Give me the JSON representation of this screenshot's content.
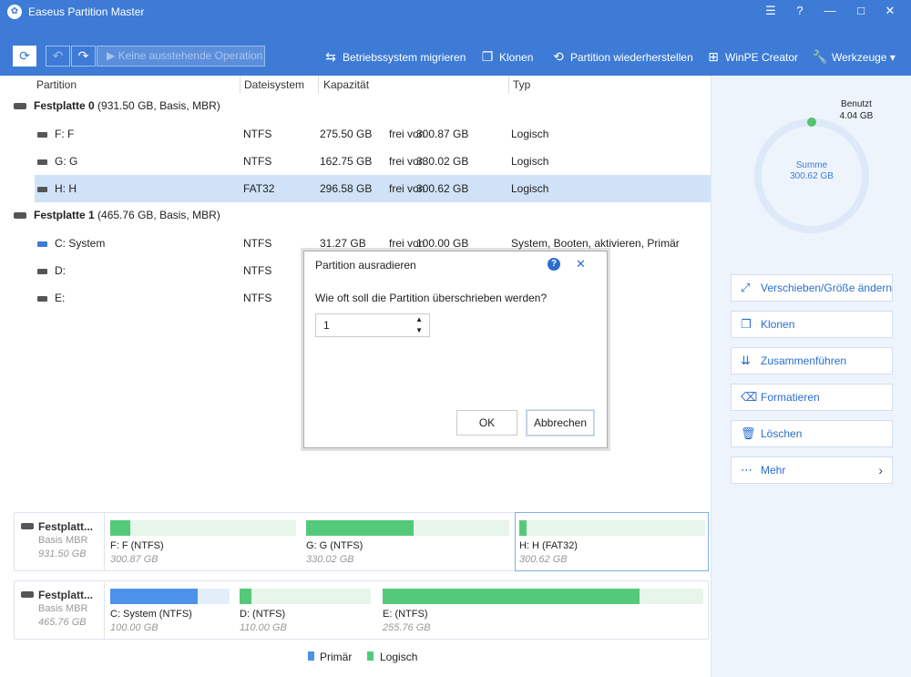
{
  "app": {
    "title": "Easeus Partition Master",
    "logo": "✿"
  },
  "window_buttons": [
    "☰",
    "?",
    "—",
    "□",
    "✕"
  ],
  "toolbar": {
    "refresh": "⟳",
    "undo": "↶",
    "redo": "↷",
    "pending_label": "Keine ausstehende Operation",
    "items": [
      {
        "label": "Betriebssystem migrieren",
        "icon": "⇆"
      },
      {
        "label": "Klonen",
        "icon": "❐"
      },
      {
        "label": "Partition wiederherstellen",
        "icon": "⟲"
      },
      {
        "label": "WinPE Creator",
        "icon": "⊞"
      },
      {
        "label": "Werkzeuge",
        "icon": "🔧",
        "arrow": "▾"
      }
    ]
  },
  "columns": [
    "Partition",
    "Dateisystem",
    "Kapazität",
    "Typ"
  ],
  "disks": [
    {
      "name": "Festplatte 0",
      "info": "(931.50 GB, Basis, MBR)",
      "partitions": [
        {
          "name": "F: F",
          "fs": "NTFS",
          "free": "275.50 GB",
          "frei": "frei von",
          "total": "300.87 GB",
          "type": "Logisch"
        },
        {
          "name": "G: G",
          "fs": "NTFS",
          "free": "162.75 GB",
          "frei": "frei von",
          "total": "330.02 GB",
          "type": "Logisch"
        },
        {
          "name": "H: H",
          "fs": "FAT32",
          "free": "296.58 GB",
          "frei": "frei von",
          "total": "300.62 GB",
          "type": "Logisch"
        }
      ]
    },
    {
      "name": "Festplatte 1",
      "info": "(465.76 GB, Basis, MBR)",
      "partitions": [
        {
          "name": "C: System",
          "fs": "NTFS",
          "free": "31.27 GB",
          "frei": "frei von",
          "total": "100.00 GB",
          "type": "System, Booten, aktivieren, Primär"
        },
        {
          "name": "D:",
          "fs": "NTFS"
        },
        {
          "name": "E:",
          "fs": "NTFS"
        }
      ]
    }
  ],
  "dialog": {
    "title": "Partition ausradieren",
    "question": "Wie oft soll die Partition überschrieben werden?",
    "value": "1",
    "ok": "OK",
    "cancel": "Abbrechen",
    "help": "?",
    "close": "✕"
  },
  "usage": {
    "used_label": "Benutzt",
    "used_value": "4.04 GB",
    "sum_label": "Summe",
    "sum_value": "300.62 GB",
    "used_fraction": 0.013
  },
  "actions": [
    {
      "label": "Verschieben/Größe ändern",
      "icon": "⤢"
    },
    {
      "label": "Klonen",
      "icon": "❐"
    },
    {
      "label": "Zusammenführen",
      "icon": "⇊"
    },
    {
      "label": "Formatieren",
      "icon": "⌫"
    },
    {
      "label": "Löschen",
      "icon": "🗑"
    },
    {
      "label": "Mehr",
      "icon": "⋯",
      "arrow": "›"
    }
  ],
  "diskmap": [
    {
      "label": "Festplatt...",
      "type": "Basis MBR",
      "size": "931.50 GB",
      "parts": [
        {
          "label": "F: F (NTFS)",
          "size": "300.87 GB",
          "used_fraction": 0.11
        },
        {
          "label": "G: G (NTFS)",
          "size": "330.02 GB",
          "used_fraction": 0.53
        },
        {
          "label": "H: H (FAT32)",
          "size": "300.62 GB",
          "used_fraction": 0.04
        }
      ]
    },
    {
      "label": "Festplatt...",
      "type": "Basis MBR",
      "size": "465.76 GB",
      "parts": [
        {
          "label": "C: System (NTFS)",
          "size": "100.00 GB",
          "used_fraction": 0.73
        },
        {
          "label": "D:  (NTFS)",
          "size": "110.00 GB",
          "used_fraction": 0.09
        },
        {
          "label": "E:  (NTFS)",
          "size": "255.76 GB",
          "used_fraction": 0.8
        }
      ]
    }
  ],
  "legend": {
    "primary": "Primär",
    "logical": "Logisch",
    "primary_color": "#4c92e8",
    "logical_color": "#55c97a"
  }
}
